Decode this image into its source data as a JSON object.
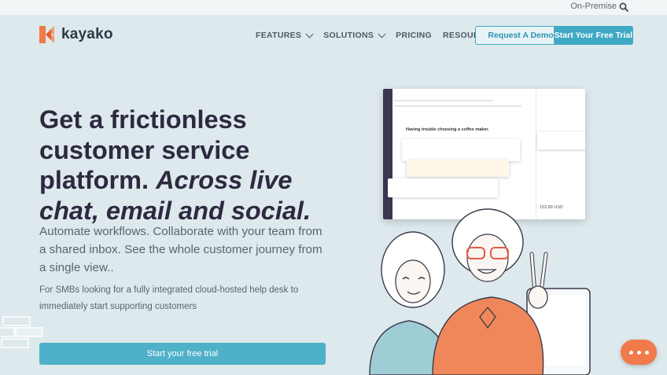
{
  "util_bar": {
    "on_premise": "On-Premise"
  },
  "nav": {
    "logo_text": "kayako",
    "links": [
      {
        "label": "FEATURES",
        "has_dropdown": true
      },
      {
        "label": "SOLUTIONS",
        "has_dropdown": true
      },
      {
        "label": "PRICING",
        "has_dropdown": false
      },
      {
        "label": "RESOURCES",
        "has_dropdown": true
      }
    ],
    "demo_button": "Request A Demo",
    "trial_button": "Start Your Free Trial"
  },
  "hero": {
    "title_plain": "Get a frictionless customer service platform.",
    "title_italic": "Across live chat, email and social.",
    "subtitle": "Automate workflows. Collaborate with your team from a shared inbox. See the whole customer journey from a single view..",
    "small_text": "For SMBs looking for a fully integrated cloud-hosted help desk to immediately start supporting customers",
    "cta": "Start your free trial"
  },
  "mockup": {
    "conversation_title": "Having trouble choosing a coffee maker.",
    "price": "152.89 USD"
  },
  "colors": {
    "background": "#dde9ec",
    "accent": "#3fa9c4",
    "heading": "#2d2a40",
    "brand_orange": "#f07a4a",
    "sidebar_dark": "#3d3651"
  },
  "icons": {
    "search": "search-icon",
    "chat": "chat-bubble-icon",
    "logo": "kayako-logo-icon"
  }
}
